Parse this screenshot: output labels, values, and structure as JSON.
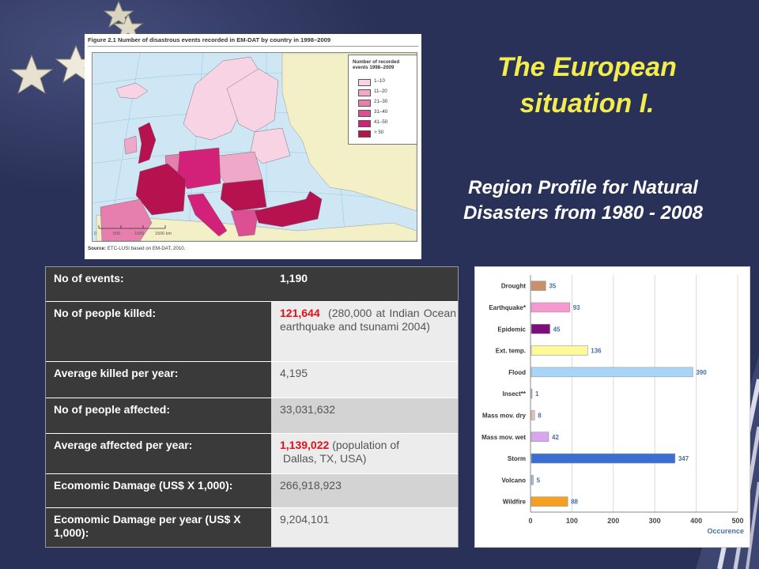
{
  "slide": {
    "title_line1": "The European",
    "title_line2": "situation I.",
    "subtitle_line1": "Region Profile for Natural",
    "subtitle_line2": "Disasters from 1980 - 2008",
    "colors": {
      "background": "#2a3158",
      "title": "#f2ec4c",
      "subtitle": "#ffffff"
    }
  },
  "map_figure": {
    "caption": "Figure 2.1  Number of disastrous events recorded in EM-DAT by country in 1998–2009",
    "legend_title": "Number of recorded events 1998–2009",
    "legend": [
      {
        "label": "1–10",
        "color": "#f7d3e4"
      },
      {
        "label": "11–20",
        "color": "#f0a8c8"
      },
      {
        "label": "21–30",
        "color": "#e67fae"
      },
      {
        "label": "31–40",
        "color": "#dc4f93"
      },
      {
        "label": "41–50",
        "color": "#d32179"
      },
      {
        "label": "> 50",
        "color": "#b5124f"
      }
    ],
    "scale_labels": [
      "0",
      "500",
      "1000",
      "1500 km"
    ],
    "source_label": "Source:",
    "source_text": "ETC-LUSI based on EM-DAT, 2010."
  },
  "profile_table": {
    "rows": [
      {
        "label": "No of events:",
        "value": "1,190"
      },
      {
        "label": "No of people killed:",
        "value_highlight": "121,644",
        "value_note": "(280,000 at Indian Ocean earthquake and tsunami 2004)"
      },
      {
        "label": "Average killed per year:",
        "value": "4,195"
      },
      {
        "label": "No of people affected:",
        "value": "33,031,632"
      },
      {
        "label": "Average affected per year:",
        "value_highlight": "1,139,022",
        "value_note": "(population of",
        "value_note2": "Dallas, TX, USA)"
      },
      {
        "label": "Ecomomic Damage (US$ X 1,000):",
        "value": "266,918,923"
      },
      {
        "label": "Ecomomic Damage per year (US$ X 1,000):",
        "value": "9,204,101"
      }
    ]
  },
  "chart_data": {
    "type": "bar",
    "orientation": "horizontal",
    "categories": [
      "Drought",
      "Earthquake*",
      "Epidemic",
      "Ext. temp.",
      "Flood",
      "Insect**",
      "Mass mov. dry",
      "Mass mov. wet",
      "Storm",
      "Volcano",
      "Wildfire"
    ],
    "values": [
      35,
      93,
      45,
      136,
      390,
      1,
      8,
      42,
      347,
      5,
      88
    ],
    "colors": [
      "#c8916a",
      "#f59ad0",
      "#7d0f7d",
      "#fdfa9a",
      "#a7d4f7",
      "#8fb0e0",
      "#e8c2b0",
      "#d7a6ee",
      "#3a6fd1",
      "#9fc1ea",
      "#f5a020"
    ],
    "xlabel": "Occurence",
    "xlim": [
      0,
      500
    ],
    "xticks": [
      0,
      100,
      200,
      300,
      400,
      500
    ],
    "grid": true
  }
}
